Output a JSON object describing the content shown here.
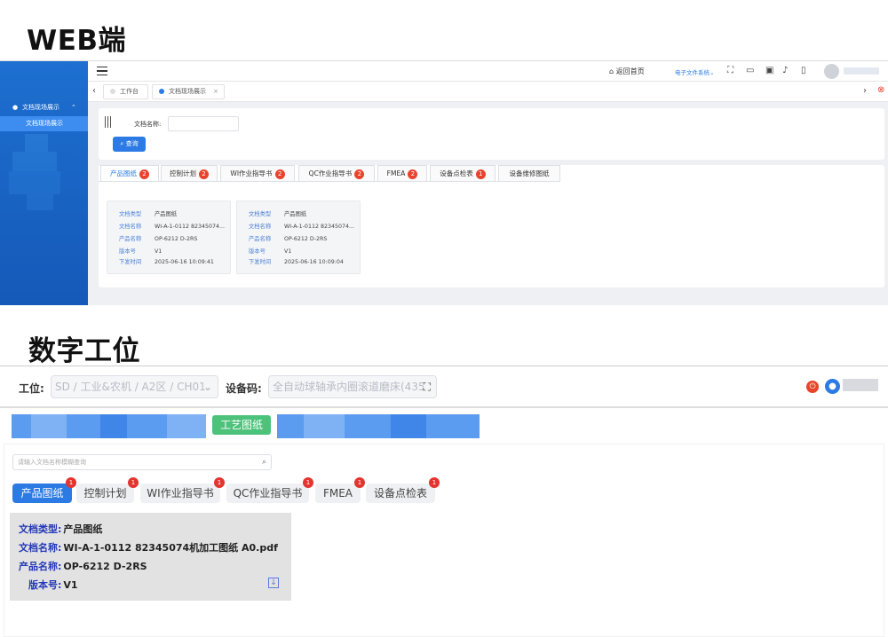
{
  "headings": {
    "web": "WEB端",
    "station": "数字工位"
  },
  "web": {
    "sidebar": {
      "menu_group": "文档现场展示",
      "menu_item": "文档现场展示"
    },
    "topbar": {
      "home_link": "返回首页",
      "system_select": "电子文件系统"
    },
    "tabs": [
      {
        "label": "工作台",
        "active": false
      },
      {
        "label": "文档现场展示",
        "active": true
      }
    ],
    "search": {
      "label": "文档名称:",
      "placeholder": "",
      "button": "查询"
    },
    "doc_tabs": [
      {
        "label": "产品图纸",
        "badge": "2",
        "active": true
      },
      {
        "label": "控制计划",
        "badge": "2",
        "active": false
      },
      {
        "label": "WI作业指导书",
        "badge": "2",
        "active": false
      },
      {
        "label": "QC作业指导书",
        "badge": "2",
        "active": false
      },
      {
        "label": "FMEA",
        "badge": "2",
        "active": false
      },
      {
        "label": "设备点检表",
        "badge": "1",
        "active": false
      },
      {
        "label": "设备维修图纸",
        "badge": "",
        "active": false
      }
    ],
    "field_labels": {
      "type": "文档类型",
      "name": "文档名称",
      "product": "产品名称",
      "version": "版本号",
      "time": "下发时间"
    },
    "docs": [
      {
        "type": "产品图纸",
        "name": "WI-A-1-0112 82345074...",
        "product": "OP-6212 D-2RS",
        "version": "V1",
        "time": "2025-06-16 10:09:41"
      },
      {
        "type": "产品图纸",
        "name": "WI-A-1-0112 82345074...",
        "product": "OP-6212 D-2RS",
        "version": "V1",
        "time": "2025-06-16 10:09:04"
      }
    ]
  },
  "station": {
    "workstation_label": "工位:",
    "workstation_value": "SD / 工业&农机 / A2区 / CH01",
    "equipment_label": "设备码:",
    "equipment_value": "全自动球轴承内圈滚道磨床(435",
    "craft_button": "工艺图纸",
    "search_placeholder": "请输入文档名称模糊查询",
    "doc_tabs": [
      {
        "label": "产品图纸",
        "badge": "1",
        "active": true
      },
      {
        "label": "控制计划",
        "badge": "1",
        "active": false
      },
      {
        "label": "WI作业指导书",
        "badge": "1",
        "active": false
      },
      {
        "label": "QC作业指导书",
        "badge": "1",
        "active": false
      },
      {
        "label": "FMEA",
        "badge": "1",
        "active": false
      },
      {
        "label": "设备点检表",
        "badge": "1",
        "active": false
      }
    ],
    "doc": {
      "type_label": "文档类型:",
      "type": "产品图纸",
      "name_label": "文档名称:",
      "name": "WI-A-1-0112 82345074机加工图纸 A0.pdf",
      "product_label": "产品名称:",
      "product": "OP-6212 D-2RS",
      "version_label": "版本号:",
      "version": "V1"
    }
  },
  "colors": {
    "primary": "#2c7be5",
    "sidebar": "#1a66c9",
    "badge": "#e8442d",
    "green": "#4cc27a",
    "label_blue": "#2338b8"
  }
}
